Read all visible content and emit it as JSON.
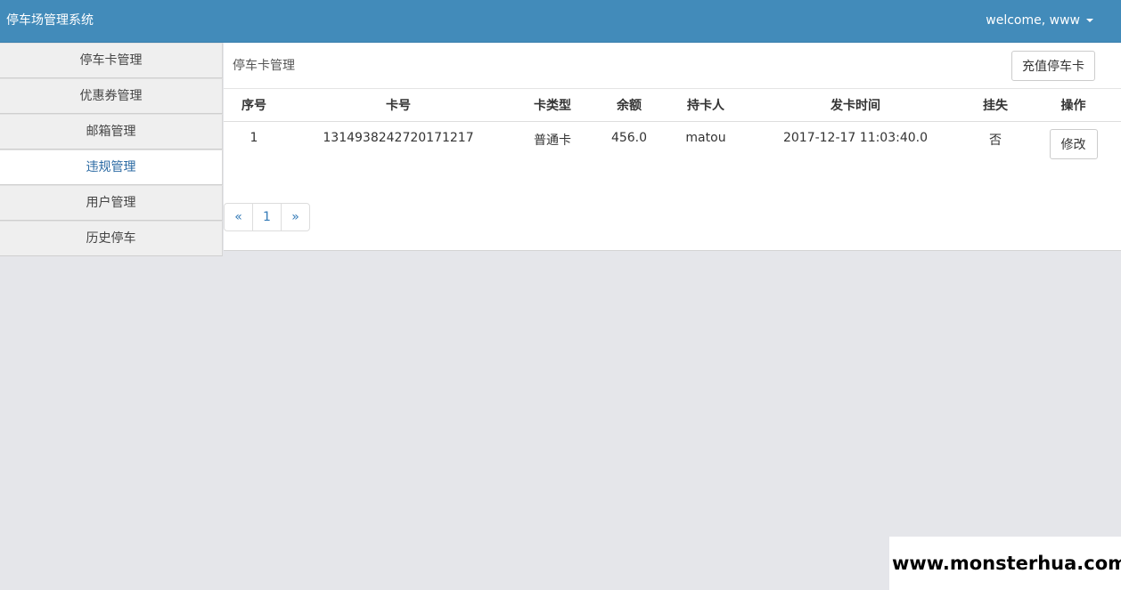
{
  "navbar": {
    "brand": "停车场管理系统",
    "user_label": "welcome, www"
  },
  "sidebar": {
    "items": [
      {
        "label": "停车卡管理"
      },
      {
        "label": "优惠券管理"
      },
      {
        "label": "邮箱管理"
      },
      {
        "label": "违规管理",
        "active": true
      },
      {
        "label": "用户管理"
      },
      {
        "label": "历史停车"
      }
    ]
  },
  "main": {
    "title": "停车卡管理",
    "recharge_label": "充值停车卡",
    "table": {
      "headers": [
        "序号",
        "卡号",
        "卡类型",
        "余额",
        "持卡人",
        "发卡时间",
        "挂失",
        "操作"
      ],
      "rows": [
        {
          "index": "1",
          "card_no": "1314938242720171217",
          "card_type": "普通卡",
          "balance": "456.0",
          "holder": "matou",
          "issue_time": "2017-12-17 11:03:40.0",
          "lost": "否",
          "action_label": "修改"
        }
      ]
    },
    "pagination": {
      "prev": "«",
      "pages": [
        "1"
      ],
      "next": "»"
    }
  },
  "watermark": {
    "text": "www.monsterhua.com"
  },
  "colors": {
    "navbar": "#428bba",
    "active_link": "#2b6aa3",
    "page_link": "#337ab7",
    "background": "#e5e6ea"
  }
}
